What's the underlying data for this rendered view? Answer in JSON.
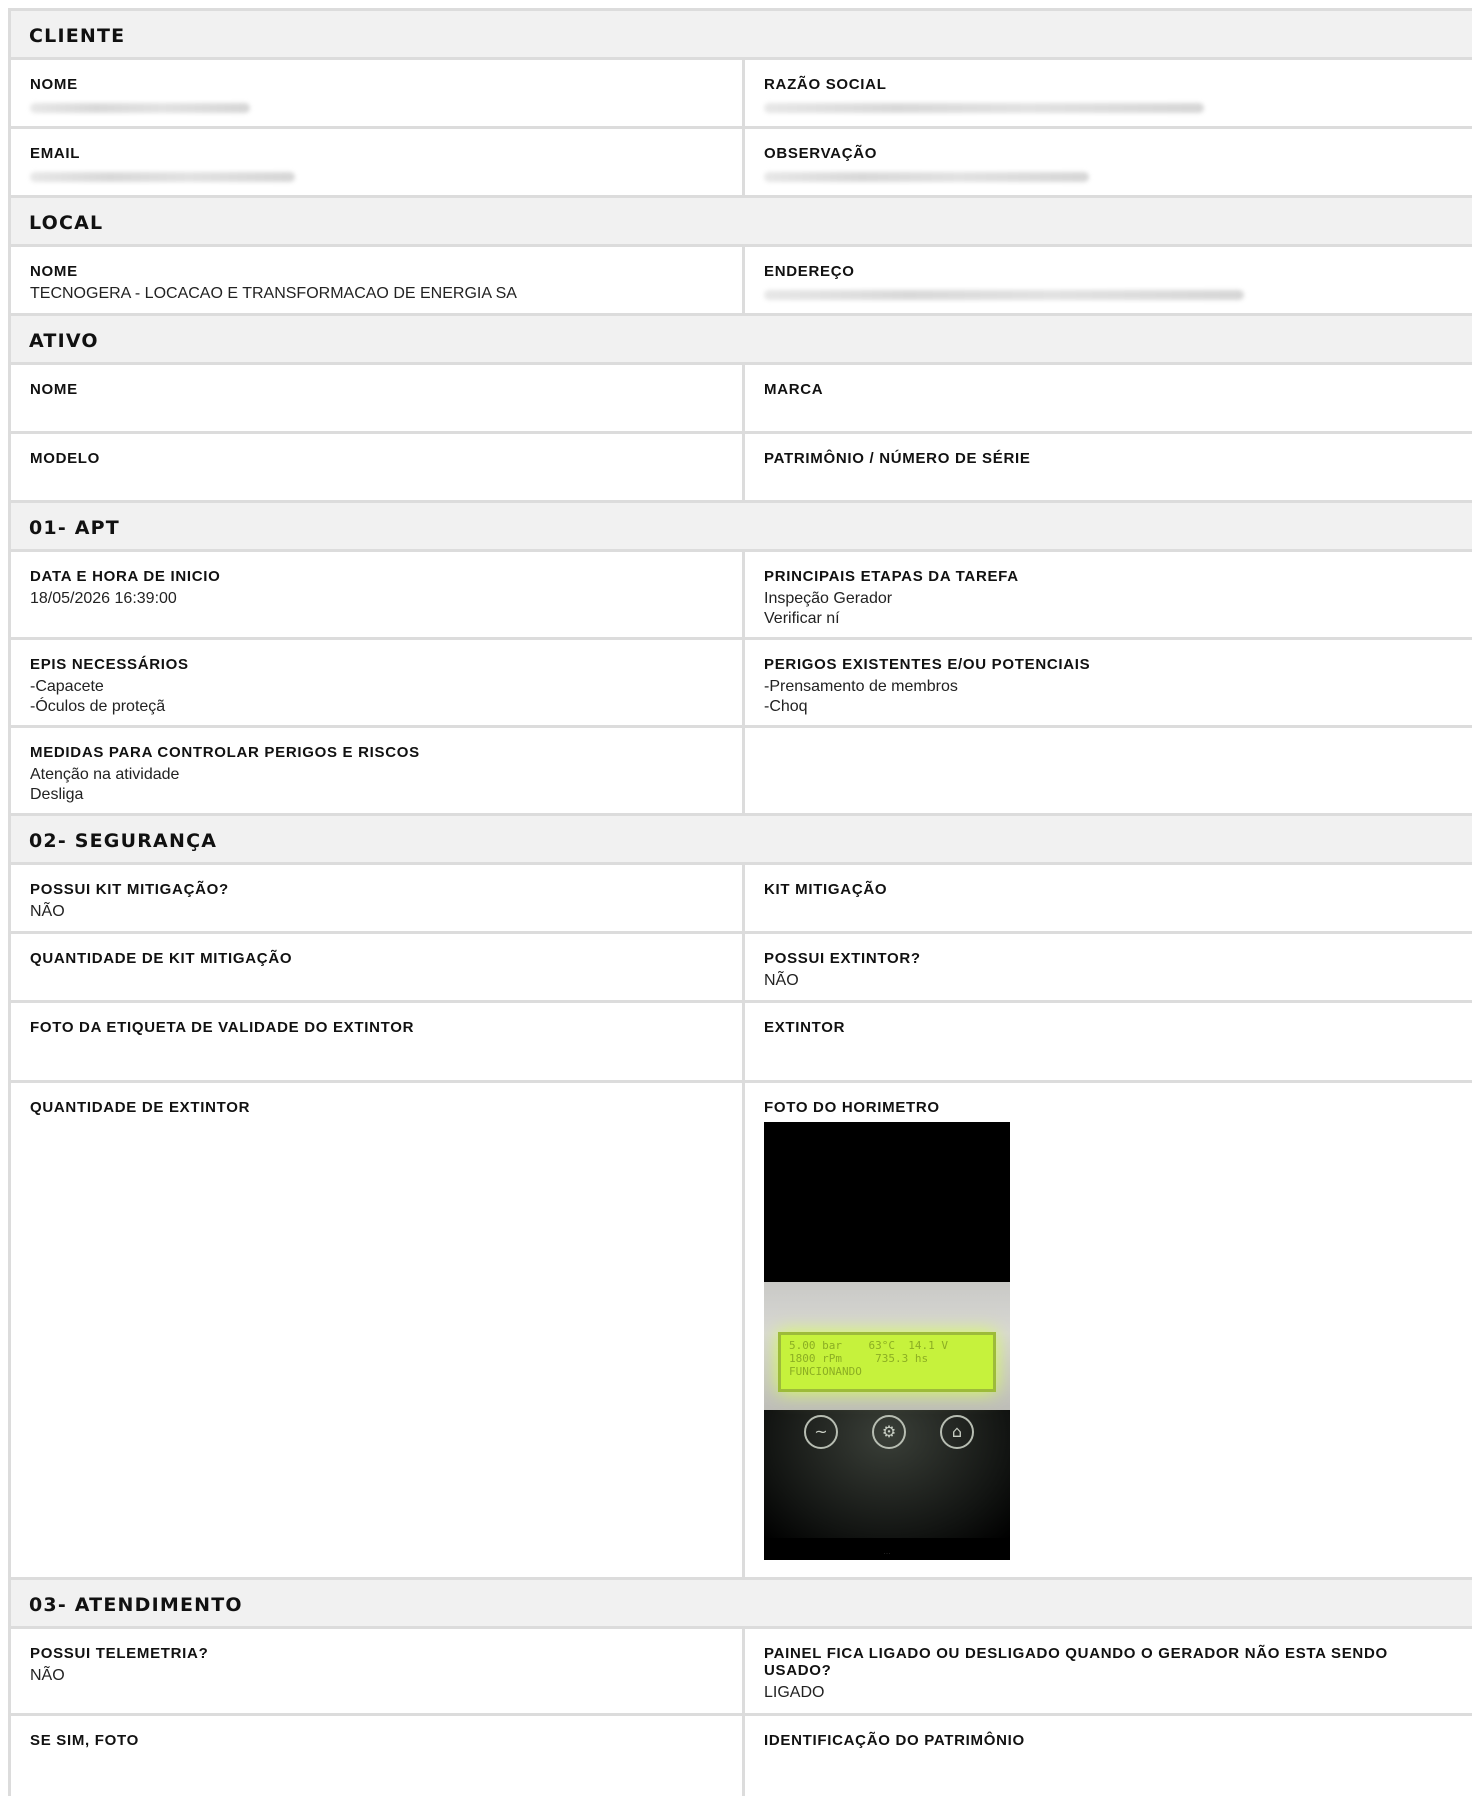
{
  "cliente": {
    "title": "CLIENTE",
    "nome_label": "NOME",
    "razao_label": "RAZÃO SOCIAL",
    "email_label": "EMAIL",
    "obs_label": "OBSERVAÇÃO"
  },
  "local": {
    "title": "LOCAL",
    "nome_label": "NOME",
    "nome_value": "TECNOGERA - LOCACAO E TRANSFORMACAO DE ENERGIA SA",
    "endereco_label": "ENDEREÇO"
  },
  "ativo": {
    "title": "ATIVO",
    "nome_label": "NOME",
    "marca_label": "MARCA",
    "modelo_label": "MODELO",
    "patrimonio_label": "PATRIMÔNIO / NÚMERO DE SÉRIE"
  },
  "apt": {
    "title": "01- APT",
    "data_label": "DATA E HORA DE INICIO",
    "data_value": "18/05/2026 16:39:00",
    "etapas_label": "PRINCIPAIS ETAPAS DA TAREFA",
    "etapas_value": "Inspeção Gerador\nVerificar ní",
    "epis_label": "EPIS NECESSÁRIOS",
    "epis_value": "-Capacete\n-Óculos de proteçã",
    "perigos_label": "PERIGOS EXISTENTES E/OU POTENCIAIS",
    "perigos_value": "-Prensamento de membros\n-Choq",
    "medidas_label": "MEDIDAS PARA CONTROLAR PERIGOS E RISCOS",
    "medidas_value": "Atenção na atividade\nDesliga"
  },
  "seguranca": {
    "title": "02- SEGURANÇA",
    "possui_kit_label": "POSSUI KIT MITIGAÇÃO?",
    "possui_kit_value": "NÃO",
    "kit_label": "KIT MITIGAÇÃO",
    "qtd_kit_label": "QUANTIDADE DE KIT MITIGAÇÃO",
    "possui_ext_label": "POSSUI EXTINTOR?",
    "possui_ext_value": "NÃO",
    "foto_etiqueta_label": "FOTO DA ETIQUETA DE VALIDADE DO EXTINTOR",
    "extintor_label": "EXTINTOR",
    "qtd_ext_label": "QUANTIDADE DE EXTINTOR",
    "foto_horimetro_label": "FOTO DO HORIMETRO",
    "lcd_text": "5.00 bar    63°C  14.1 V\n1800 rPm     735.3 hs\nFUNCIONANDO"
  },
  "atendimento": {
    "title": "03- ATENDIMENTO",
    "telemetria_label": "POSSUI TELEMETRIA?",
    "telemetria_value": "NÃO",
    "painel_label": "PAINEL FICA LIGADO OU DESLIGADO QUANDO O GERADOR NÃO ESTA SENDO USADO?",
    "painel_value": "LIGADO",
    "se_sim_label": "SE SIM, FOTO",
    "identificacao_label": "IDENTIFICAÇÃO DO PATRIMÔNIO"
  }
}
